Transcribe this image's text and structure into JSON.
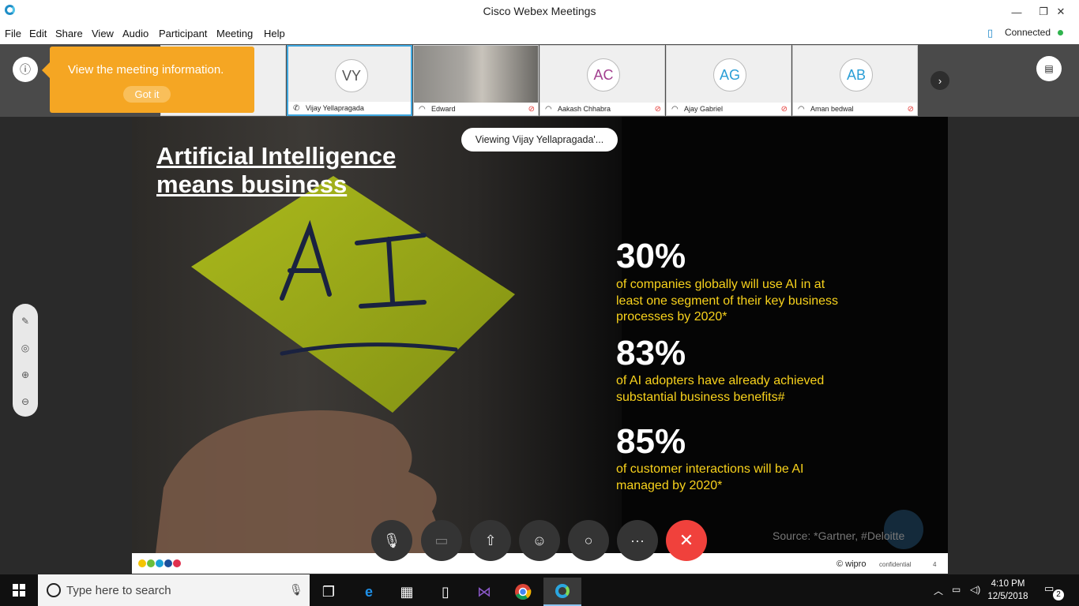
{
  "window": {
    "title": "Cisco Webex Meetings",
    "minimize": "—",
    "restore": "❐",
    "close": "✕"
  },
  "menu": [
    "File",
    "Edit",
    "Share",
    "View",
    "Audio",
    "Participant",
    "Meeting",
    "Help"
  ],
  "status": {
    "connection": "Connected"
  },
  "tooltip": {
    "text": "View the meeting information.",
    "button": "Got it"
  },
  "participants": [
    {
      "initials": "VY",
      "name": "Vijay Yellapragada",
      "active": true
    },
    {
      "initials": "",
      "name": "Edward",
      "video": true
    },
    {
      "initials": "AC",
      "name": "Aakash Chhabra",
      "color": "#a23f8f"
    },
    {
      "initials": "AG",
      "name": "Ajay Gabriel",
      "color": "#2a9ed6"
    },
    {
      "initials": "AB",
      "name": "Aman bedwal",
      "color": "#2a9ed6"
    }
  ],
  "viewing": "Viewing Vijay Yellapragada'...",
  "slide": {
    "title_line1": "Artificial Intelligence",
    "title_line2": "means business",
    "stats": [
      {
        "value": "30%",
        "text": "of companies globally will use AI in at least one segment of their key business processes by 2020*"
      },
      {
        "value": "83%",
        "text": "of AI adopters have already achieved substantial business benefits#"
      },
      {
        "value": "85%",
        "text": "of customer interactions will be AI managed by 2020*"
      }
    ],
    "source": "Source: *Gartner, #Deloitte",
    "sticky_note": "AI",
    "footer_brand": "© wipro",
    "footer_confidential": "confidential",
    "footer_page": "4",
    "dot_colors": [
      "#f5c400",
      "#6abf3b",
      "#1aa0d8",
      "#1b4f9c",
      "#e0304e"
    ]
  },
  "taskbar": {
    "search_placeholder": "Type here to search",
    "time": "4:10 PM",
    "date": "12/5/2018",
    "notifications": "2"
  }
}
